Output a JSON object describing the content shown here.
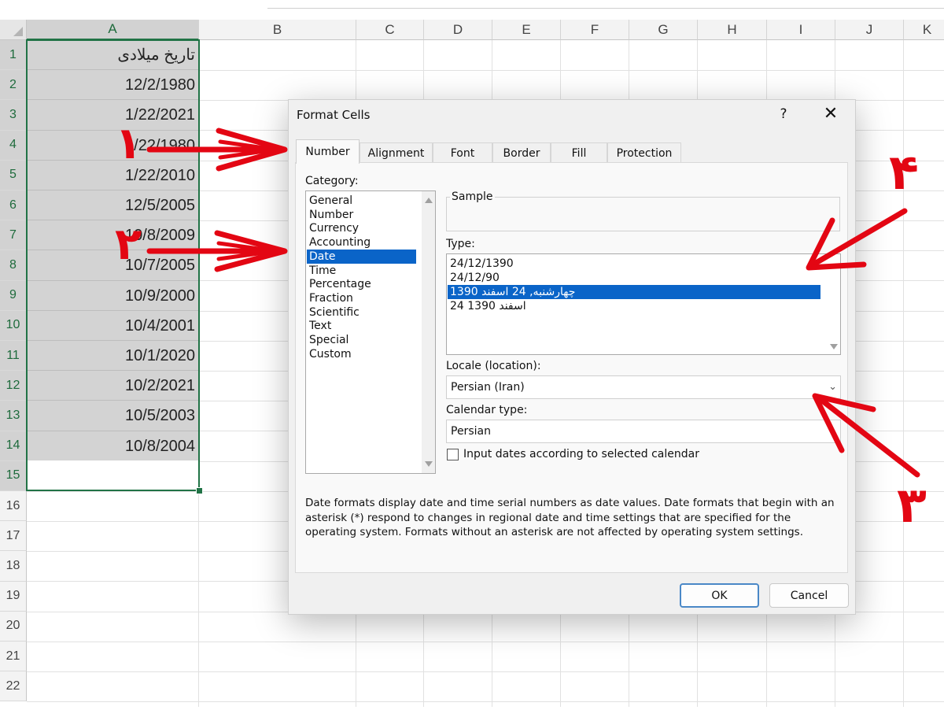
{
  "sheet": {
    "columns": [
      "A",
      "B",
      "C",
      "D",
      "E",
      "F",
      "G",
      "H",
      "I",
      "J",
      "K"
    ],
    "rows": [
      "1",
      "2",
      "3",
      "4",
      "5",
      "6",
      "7",
      "8",
      "9",
      "10",
      "11",
      "12",
      "13",
      "14",
      "15",
      "16",
      "17",
      "18",
      "19",
      "20",
      "21",
      "22"
    ],
    "col_a": [
      "تاریخ میلادی",
      "12/2/1980",
      "1/22/2021",
      "1/22/1980",
      "1/22/2010",
      "12/5/2005",
      "10/8/2009",
      "10/7/2005",
      "10/9/2000",
      "10/4/2001",
      "10/1/2020",
      "10/2/2021",
      "10/5/2003",
      "10/8/2004"
    ],
    "selection_color": "#217346"
  },
  "dialog": {
    "title": "Format Cells",
    "help": "?",
    "close": "✕",
    "tabs": [
      "Number",
      "Alignment",
      "Font",
      "Border",
      "Fill",
      "Protection"
    ],
    "active_tab": "Number",
    "category_label": "Category:",
    "categories": [
      "General",
      "Number",
      "Currency",
      "Accounting",
      "Date",
      "Time",
      "Percentage",
      "Fraction",
      "Scientific",
      "Text",
      "Special",
      "Custom"
    ],
    "selected_category": "Date",
    "sample_label": "Sample",
    "type_label": "Type:",
    "types": [
      "24/12/1390",
      "24/12/90",
      "چهارشنبه, 24 اسفند 1390",
      "24 اسفند 1390"
    ],
    "selected_type_index": 2,
    "locale_label": "Locale (location):",
    "locale_value": "Persian (Iran)",
    "calendar_label": "Calendar type:",
    "calendar_value": "Persian",
    "checkbox_label": "Input dates according to selected calendar",
    "checkbox_checked": false,
    "description": "Date formats display date and time serial numbers as date values.  Date formats that begin with an asterisk (*) respond to changes in regional date and time settings that are specified for the operating system. Formats without an asterisk are not affected by operating system settings.",
    "ok_label": "OK",
    "cancel_label": "Cancel",
    "highlight_color": "#0a64c8"
  },
  "annotations": {
    "color": "#e30613",
    "numbers": [
      "۱",
      "۲",
      "۳",
      "۴"
    ]
  }
}
